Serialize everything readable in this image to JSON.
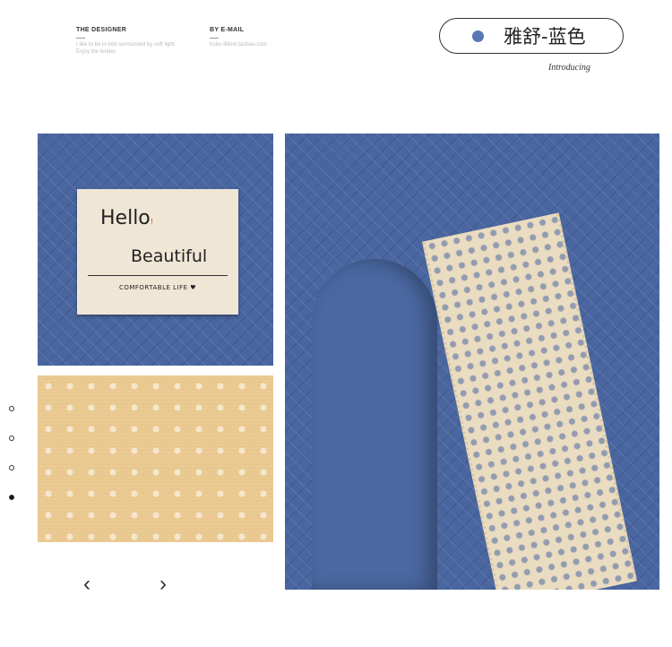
{
  "header": {
    "designer": {
      "title": "THE DESIGNER",
      "sub": "I like to be in bed surrounded by soft light. Enjoy the tender."
    },
    "email": {
      "title": "BY E-MAIL",
      "sub": "hobo-lilitem.taobao.com"
    },
    "color_badge": {
      "label": "雅舒-蓝色",
      "dot_color": "#5977b4"
    },
    "introducing": "Introducing"
  },
  "label_tag": {
    "line1": "Hello",
    "line1_mark": "!",
    "line2": "Beautiful",
    "line3": "COMFORTABLE LIFE ♥"
  },
  "carousel": {
    "dots": [
      {
        "active": false
      },
      {
        "active": false
      },
      {
        "active": false
      },
      {
        "active": true
      }
    ],
    "prev_icon": "‹",
    "next_icon": "›"
  },
  "colors": {
    "fabric_blue": "#4a66a0",
    "beige_backing": "#e9c88f",
    "lace": "#eadcc1"
  }
}
